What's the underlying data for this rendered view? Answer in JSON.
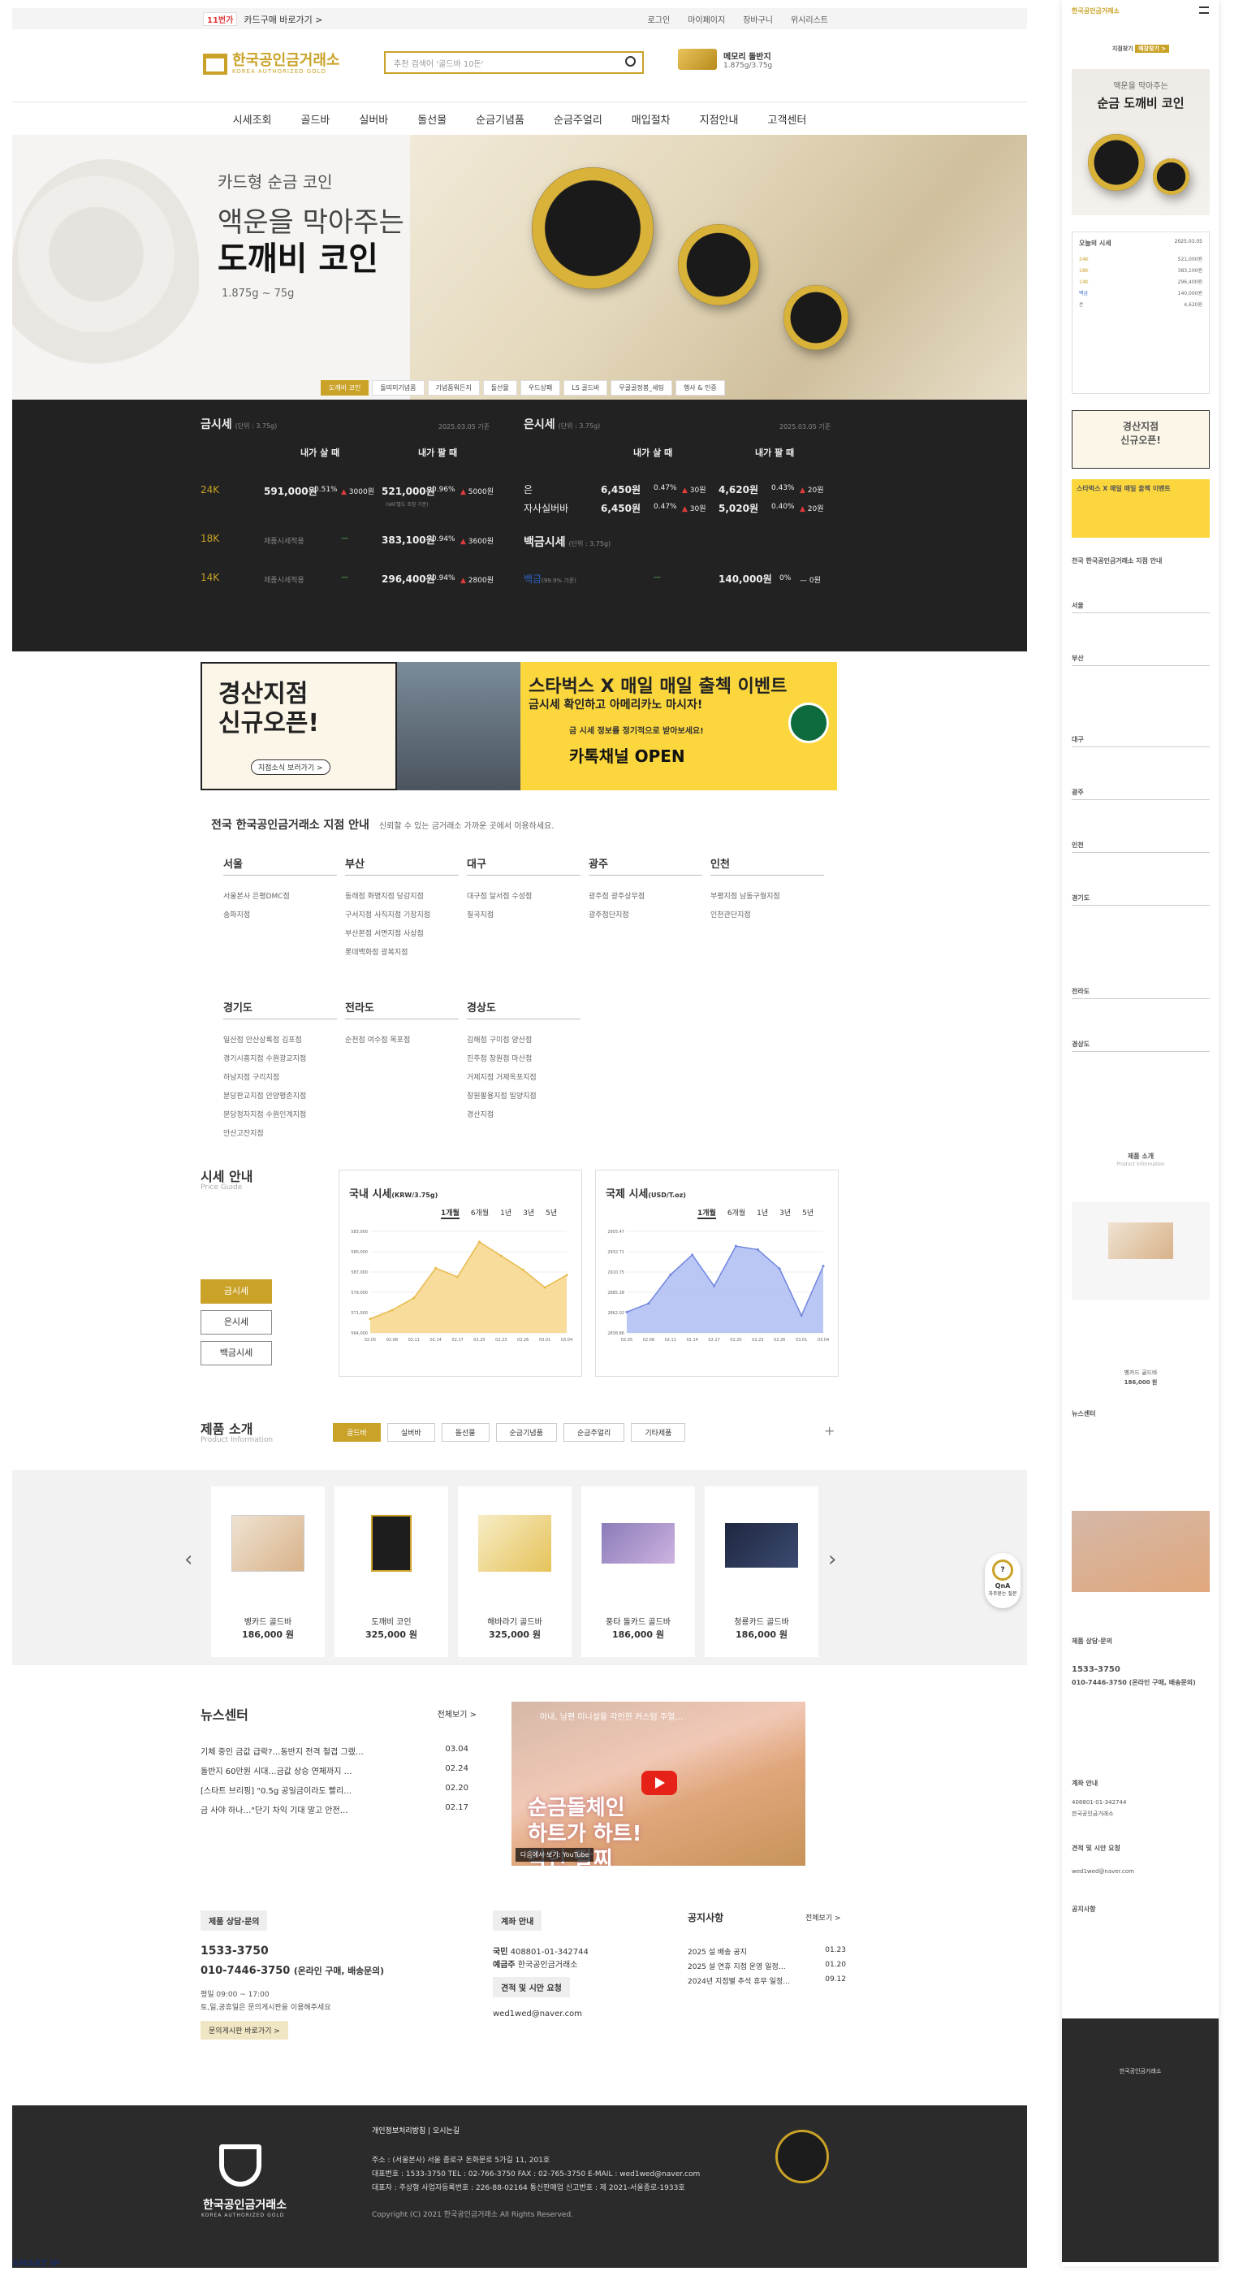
{
  "topbar": {
    "card_tag": "11번가",
    "card_text": "카드구매 바로가기 >",
    "links": [
      "로그인",
      "마이페이지",
      "장바구니",
      "위시리스트"
    ]
  },
  "header": {
    "logo_title": "한국공인금거래소",
    "logo_sub": "KOREA AUTHORIZED GOLD",
    "search_placeholder": "추천 검색어 '골드바 10돈'",
    "promo_title": "메모리 돌반지",
    "promo_sub": "1.875g/3.75g"
  },
  "nav": [
    "시세조회",
    "골드바",
    "실버바",
    "돌선물",
    "순금기념품",
    "순금주얼리",
    "매입절차",
    "지점안내",
    "고객센터"
  ],
  "hero": {
    "kicker": "카드형 순금 코인",
    "line1": "액운을 막아주는",
    "line2": "도깨비 코인",
    "weights": "1.875g ~ 75g",
    "tabs": [
      "도깨비 코인",
      "돌띠미기념품",
      "기념품뭐든지",
      "돌선물",
      "우드상패",
      "LS 골드바",
      "무골골정봉_세팅",
      "행사 & 인증"
    ]
  },
  "market": {
    "gold": {
      "title": "금시세",
      "unit": "(단위 : 3.75g)",
      "date": "2025.03.05 기준",
      "col_buy": "내가 살 때",
      "col_sell": "내가 팔 때",
      "rows": [
        {
          "k": "24K",
          "buy": "591,000원",
          "buy_pct": "0.51%",
          "buy_diff": "3000원",
          "sell": "521,000원",
          "sell_pct": "0.96%",
          "sell_diff": "5000원",
          "note": "(VAT별도 포함 기준)"
        },
        {
          "k": "18K",
          "buy": "제품시세적용",
          "buy_pct": "",
          "buy_diff": "—",
          "sell": "383,100원",
          "sell_pct": "0.94%",
          "sell_diff": "3600원",
          "note": ""
        },
        {
          "k": "14K",
          "buy": "제품시세적용",
          "buy_pct": "",
          "buy_diff": "—",
          "sell": "296,400원",
          "sell_pct": "0.94%",
          "sell_diff": "2800원",
          "note": ""
        }
      ]
    },
    "silver": {
      "title": "은시세",
      "unit": "(단위 : 3.75g)",
      "date": "2025.03.05 기준",
      "col_buy": "내가 살 때",
      "col_sell": "내가 팔 때",
      "rows": [
        {
          "k": "은",
          "buy": "6,450원",
          "buy_pct": "0.47%",
          "buy_diff": "30원",
          "sell": "4,620원",
          "sell_pct": "0.43%",
          "sell_diff": "20원"
        },
        {
          "k": "자사실버바",
          "buy": "6,450원",
          "buy_pct": "0.47%",
          "buy_diff": "30원",
          "sell": "5,020원",
          "sell_pct": "0.40%",
          "sell_diff": "20원"
        }
      ]
    },
    "platinum": {
      "title": "백금시세",
      "unit": "(단위 : 3.75g)",
      "k": "백금",
      "k_note": "(99.9% 기준)",
      "buy": "—",
      "sell": "140,000원",
      "sell_pct": "0%",
      "sell_diff": "0원"
    }
  },
  "banner": {
    "b1": "경산지점\n신규오픈!",
    "b1_sub": "지점소식 보러가기 >",
    "b3_top": "스타벅스 X 매일 매일 출첵 이벤트",
    "b3_mid": "금시세 확인하고 아메리카노 마시자!",
    "b3_bot": "카톡채널 OPEN",
    "b3_small": "금 시세 정보를 정기적으로 받아보세요!"
  },
  "branch": {
    "title": "전국 한국공인금거래소 지점 안내",
    "sub": "신뢰할 수 있는 금거래소 가까운 곳에서 이용하세요.",
    "regions": [
      {
        "name": "서울",
        "items": [
          "서울본사  은평DMC점",
          "송파지점"
        ]
      },
      {
        "name": "부산",
        "items": [
          "동래점  화명지점  당감지점",
          "구서지점  사직지점  기장지점",
          "부산본점  서면지점  사상점",
          "롯데백화점 광복지점"
        ]
      },
      {
        "name": "대구",
        "items": [
          "대구점  달서점  수성점",
          "칠곡지점"
        ]
      },
      {
        "name": "광주",
        "items": [
          "광주점  광주상무점",
          "광주첨단지점"
        ]
      },
      {
        "name": "인천",
        "items": [
          "부평지점  남동구월지점",
          "인천관단지점"
        ]
      },
      {
        "name": "경기도",
        "items": [
          "일산점  안산상록점  김포점",
          "경기시흥지점  수원광교지점",
          "하남지점  구리지점",
          "분당판교지점  안양평촌지점",
          "분당정자지점  수원인계지점",
          "안산고잔지점"
        ]
      },
      {
        "name": "전라도",
        "items": [
          "순천점  여수점  목포점"
        ]
      },
      {
        "name": "경상도",
        "items": [
          "김해점  구미점  양산점",
          "진주점  창원점  마산점",
          "거제지점  거제옥포지점",
          "창원팔용지점  밀양지점",
          "경산지점"
        ]
      }
    ]
  },
  "price_guide": {
    "title": "시세 안내",
    "sub": "Price Guide",
    "buttons": [
      "금시세",
      "은시세",
      "백금시세"
    ],
    "domestic": {
      "title": "국내 시세",
      "unit": "(KRW/3.75g)",
      "ranges": [
        "1개월",
        "6개월",
        "1년",
        "3년",
        "5년"
      ],
      "yticks": [
        "583,000",
        "580,000",
        "587,000",
        "579,000",
        "571,000",
        "564,000"
      ]
    },
    "world": {
      "title": "국제 시세",
      "unit": "(USD/T.oz)",
      "ranges": [
        "1개월",
        "6개월",
        "1년",
        "3년",
        "5년"
      ],
      "yticks": [
        "2955.47",
        "2932.71",
        "2910.75",
        "2885.38",
        "2862.02",
        "2838.86"
      ]
    }
  },
  "chart_data": [
    {
      "type": "area",
      "title": "국내 시세",
      "xlabel": "",
      "ylabel": "KRW/3.75g",
      "x": [
        "02.05",
        "02.08",
        "02.11",
        "02.14",
        "02.17",
        "02.20",
        "02.23",
        "02.26",
        "03.01",
        "03.04"
      ],
      "series": [
        {
          "values": [
            568000,
            570500,
            574000,
            582500,
            580000,
            590000,
            586000,
            582000,
            577000,
            580500
          ]
        }
      ],
      "ylim": [
        564000,
        593000
      ]
    },
    {
      "type": "area",
      "title": "국제 시세",
      "xlabel": "",
      "ylabel": "USD/T.oz",
      "x": [
        "02.05",
        "02.08",
        "02.11",
        "02.14",
        "02.17",
        "02.20",
        "02.23",
        "02.26",
        "03.01",
        "03.04"
      ],
      "series": [
        {
          "values": [
            2862,
            2872,
            2905,
            2928,
            2892,
            2938,
            2934,
            2912,
            2858,
            2915
          ]
        }
      ],
      "ylim": [
        2838,
        2955
      ]
    }
  ],
  "products": {
    "title": "제품 소개",
    "sub": "Product Information",
    "tabs": [
      "골드바",
      "실버바",
      "돌선물",
      "순금기념품",
      "순금주얼리",
      "기타제품"
    ],
    "items": [
      {
        "n": "벵카드 골드바",
        "p": "186,000 원"
      },
      {
        "n": "도깨비 코인",
        "p": "325,000 원"
      },
      {
        "n": "해바라기 골드바",
        "p": "325,000 원"
      },
      {
        "n": "풍타 돌카드 골드바",
        "p": "186,000 원"
      },
      {
        "n": "청룡카드 골드바",
        "p": "186,000 원"
      }
    ]
  },
  "qna": {
    "label": "QnA",
    "sub": "자주묻는 질문"
  },
  "news": {
    "title": "뉴스센터",
    "more": "전체보기 >",
    "items": [
      {
        "t": "기체 중인 금값 급락?…동반지 전격 철겹 그렜…",
        "d": "03.04"
      },
      {
        "t": "돌반지 60만원 시대…금값 상승 연체까지 …",
        "d": "02.24"
      },
      {
        "t": "[스타트 브리핑] \"0.5g 공일금이라도 빨리…",
        "d": "02.20"
      },
      {
        "t": "금 사야 하나…\"단기 차익 기대 말고 안전…",
        "d": "02.17"
      }
    ]
  },
  "video": {
    "title": "아내, 남편 미니설을 각인한 커스텀 주얼…",
    "big": "순금돌체인\n하트가 하트!\n각인 팔찌",
    "bottom": "다음에서 보기: YouTube"
  },
  "contact": {
    "h1": "제품 상담·문의",
    "phone1": "1533-3750",
    "phone2": "010-7446-3750",
    "phone2_note": "(온라인 구매, 배송문의)",
    "hours": "평일 09:00 ~ 17:00",
    "holiday": "토,일,공휴일은 문의게시판을 이용해주세요",
    "btn": "문의게시판 바로가기 >",
    "h2": "계좌 안내",
    "bank": "국민",
    "account": "408801-01-342744",
    "holder_l": "예금주",
    "holder": "한국공인금거래소",
    "h3": "견적 및 시안 요청",
    "email": "wed1wed@naver.com",
    "h4": "공지사항",
    "more": "전체보기 >",
    "notices": [
      {
        "t": "2025 설 배송 공지",
        "d": "01.23"
      },
      {
        "t": "2025 설 연휴 지점 운영 일정…",
        "d": "01.20"
      },
      {
        "t": "2024년 지점별 추석 휴무 일정…",
        "d": "09.12"
      }
    ]
  },
  "footer": {
    "logo": "한국공인금거래소",
    "logo_sub": "KOREA AUTHORIZED GOLD",
    "links": "개인정보처리방침  |  오시는길",
    "addr": "주소 : (서울본사) 서울 종로구 돈화문로 5가길 11, 201호",
    "tel": "대표번호 : 1533-3750    TEL : 02-766-3750    FAX : 02-765-3750    E-MAIL : wed1wed@naver.com",
    "ceo": "대표자 : 주상형    사업자등록번호 : 226-88-02164    통신판매업 신고번호 : 제 2021-서울종로-1933호",
    "copy": "Copyright (C) 2021 한국공인금거래소 All Rights Reserved."
  },
  "smart": "SMART IP",
  "mobile": {
    "store": "지점찾기",
    "store_btn": "매장찾기 >",
    "hero1": "액운을 막아주는",
    "hero2": "순금 도깨비 코인",
    "today": "오늘의 시세",
    "date": "2025.03.05",
    "prod_title": "제품 소개",
    "prod_sub": "Product Information",
    "prod_tabs": [
      "골드바",
      "실버바",
      "돌선물",
      "순금기념품",
      "순금주얼리",
      "기타제품"
    ],
    "prod_item": "벵카드 골드바",
    "prod_price": "186,000 원",
    "regions": [
      "서울",
      "부산",
      "대구",
      "광주",
      "인천",
      "경기도",
      "전라도",
      "경상도"
    ],
    "news": "뉴스센터",
    "contact": "제품 상담·문의",
    "phone1": "1533-3750",
    "phone2": "010-7446-3750 (온라인 구매, 배송문의)",
    "account_h": "계좌 안내",
    "account": "408801-01-342744",
    "holder": "한국공인금거래소",
    "quote": "견적 및 시안 요청",
    "email": "wed1wed@naver.com",
    "notice": "공지사항",
    "footer_logo": "한국공인금거래소"
  }
}
